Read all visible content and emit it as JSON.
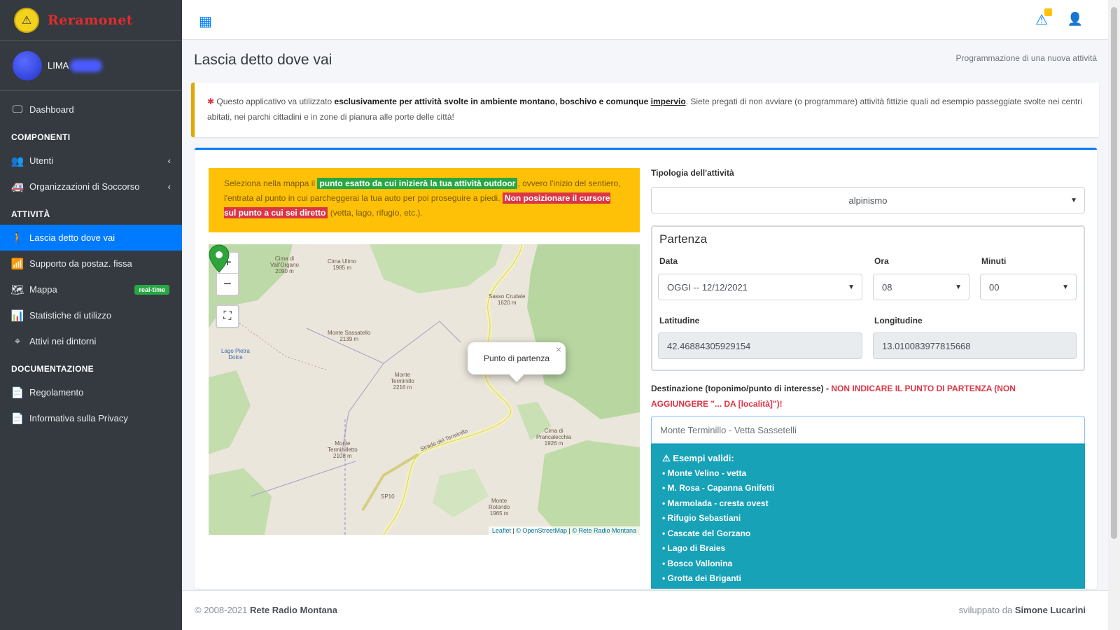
{
  "brand": {
    "name": "Reramonet",
    "logo_icon": "⚠"
  },
  "user": {
    "name": "LIMA"
  },
  "sidebar": {
    "dashboard": "Dashboard",
    "header_components": "COMPONENTI",
    "utenti": "Utenti",
    "organizzazioni": "Organizzazioni di Soccorso",
    "header_activity": "ATTIVITÀ",
    "lascia": "Lascia detto dove vai",
    "supporto": "Supporto da postaz. fissa",
    "mappa": "Mappa",
    "mappa_badge": "real-time",
    "statistiche": "Statistiche di utilizzo",
    "attivi": "Attivi nei dintorni",
    "header_docs": "DOCUMENTAZIONE",
    "regolamento": "Regolamento",
    "privacy": "Informativa sulla Privacy"
  },
  "page": {
    "title": "Lascia detto dove vai",
    "breadcrumb": "Programmazione di una nuova attività"
  },
  "callout": {
    "t1": "Questo applicativo va utilizzato",
    "t2": "esclusivamente per attività svolte in ambiente montano, boschivo e comunque",
    "t3": "impervio",
    "t4": ". Siete pregati di non avviare (o programmare) attività fittizie quali ad esempio passeggiate svolte nei centri abitati, nei parchi cittadini e in zone di pianura alle porte delle città!"
  },
  "instructions": {
    "t1": "Seleziona nella mappa il",
    "t2": "punto esatto da cui inizierà la tua attività outdoor",
    "t3": ", ovvero l'inizio del sentiero, l'entrata al punto in cui parcheggerai la tua auto per poi proseguire a piedi.",
    "t4": "Non posizionare il cursore sul punto a cui sei diretto",
    "t5": "(vetta, lago, rifugio, etc.)."
  },
  "map": {
    "popup": "Punto di partenza",
    "attribution_1": "Leaflet",
    "attribution_2": "© OpenStreetMap",
    "attribution_3": "© Rete Radio Montana",
    "labels": {
      "l1": "Cima di\nVall'Organo\n2090 m",
      "l2": "Cima Ulimo\n1985 m",
      "l3": "Sasso Crudale\n1620 m",
      "l4": "Monte Sassatello\n2139 m",
      "l5": "Monte\nTerminillo\n2216 m",
      "l6": "Cima di\nPrancalecchia\n1926 m",
      "l7": "Monte\nTerminilletto\n2108 m",
      "l8": "Monte\nRotondo\n1965 m",
      "road": "Strada del Terminillo",
      "sp10": "SP10",
      "lake": "Lago Pietra\nDolce"
    }
  },
  "form": {
    "tipologia_label": "Tipologia dell'attività",
    "tipologia_value": "alpinismo",
    "partenza_legend": "Partenza",
    "data_label": "Data",
    "data_value": "OGGI -- 12/12/2021",
    "ora_label": "Ora",
    "ora_value": "08",
    "minuti_label": "Minuti",
    "minuti_value": "00",
    "lat_label": "Latitudine",
    "lat_value": "42.46884305929154",
    "lon_label": "Longitudine",
    "lon_value": "13.010083977815668",
    "dest_label": "Destinazione (toponimo/punto di interesse) -",
    "dest_warning": "NON INDICARE IL PUNTO DI PARTENZA (NON AGGIUNGERE \"... DA [località]\")!",
    "dest_value": "Monte Terminillo - Vetta Sassetelli",
    "examples_title": "Esempi validi:",
    "examples": [
      "• Monte Velino - vetta",
      "• M. Rosa - Capanna Gnifetti",
      "• Marmolada - cresta ovest",
      "• Rifugio Sebastiani",
      "• Cascate del Gorzano",
      "• Lago di Braies",
      "• Bosco Vallonina",
      "• Grotta dei Briganti"
    ]
  },
  "footer": {
    "copyright": "© 2008-2021",
    "org": "Rete Radio Montana",
    "dev_prefix": "sviluppato da",
    "dev_name": "Simone Lucarini"
  },
  "colors": {
    "sidebar_bg": "#343a40",
    "active": "#007bff",
    "warning": "#ffc107",
    "info": "#17a2b8",
    "danger": "#dc3545",
    "success": "#28a745"
  }
}
